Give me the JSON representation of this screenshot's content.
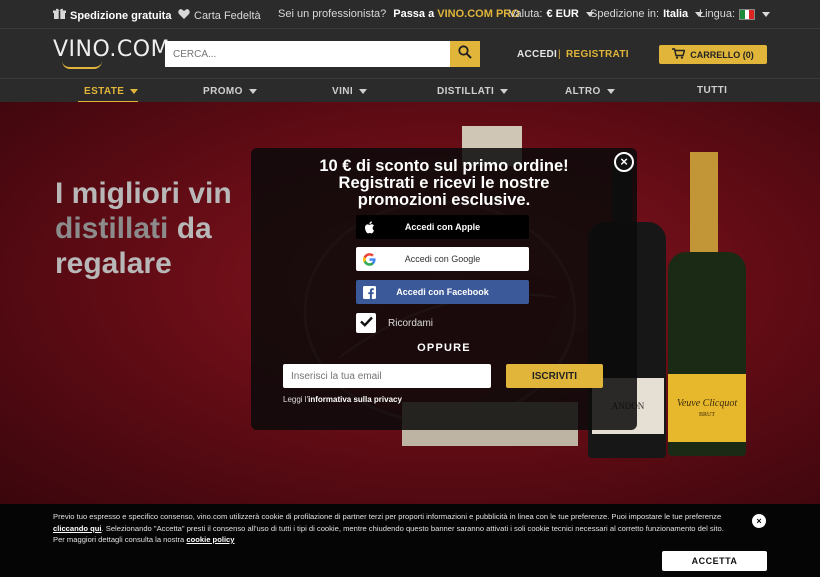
{
  "colors": {
    "accent": "#e0b53a",
    "header_bg": "#2b2b2b",
    "hero_bg": "#6a0e17",
    "facebook": "#3b5998"
  },
  "topbar": {
    "shipping": "Spedizione gratuita",
    "loyalty": "Carta Fedeltà",
    "pro_question": "Sei un professionista?",
    "pro_link_prefix": "Passa a",
    "pro_link": "VINO.COM PRO",
    "currency_label": "Valuta:",
    "currency_value": "€ EUR",
    "ship_label": "Spedizione in:",
    "ship_value": "Italia",
    "language_label": "Lingua:"
  },
  "header": {
    "logo": "VINO.COM",
    "search_placeholder": "CERCA...",
    "login": "ACCEDI",
    "separator": "|",
    "register": "REGISTRATI",
    "cart": "CARRELLO (0)"
  },
  "nav": {
    "items": [
      {
        "label": "ESTATE",
        "active": true,
        "dropdown": true
      },
      {
        "label": "PROMO",
        "dropdown": true
      },
      {
        "label": "VINI",
        "dropdown": true
      },
      {
        "label": "DISTILLATI",
        "dropdown": true
      },
      {
        "label": "ALTRO",
        "dropdown": true
      },
      {
        "label": "TUTTI",
        "dropdown": false
      }
    ]
  },
  "hero": {
    "line1": "I migliori vin",
    "line2_a": "distillati",
    "line2_b": "da",
    "line3": "regalare",
    "bottle_label_1": "ANDON",
    "bottle_label_2": "Veuve Clicquot",
    "bottle_label_3": "BRUT"
  },
  "modal": {
    "title_line1": "10 € di sconto sul primo ordine!",
    "title_line2": "Registrati e ricevi le nostre",
    "title_line3": "promozioni esclusive.",
    "apple": "Accedi con Apple",
    "google": "Accedi con Google",
    "facebook": "Accedi con Facebook",
    "remember": "Ricordami",
    "or": "OPPURE",
    "email_placeholder": "Inserisci la tua email",
    "subscribe": "ISCRIVITI",
    "privacy_prefix": "Leggi l'",
    "privacy_link": "informativa sulla privacy",
    "close": "×"
  },
  "cookie": {
    "text_1": "Previo tuo espresso e specifico consenso, vino.com utilizzerà cookie di profilazione di partner terzi per proporti informazioni e pubblicità in linea con le tue preferenze. Puoi impostare le tue preferenze ",
    "link_1": "cliccando qui",
    "text_2": ". Selezionando \"Accetta\" presti il consenso all'uso di tutti i tipi di cookie, mentre chiudendo questo banner saranno attivati i soli cookie tecnici necessari al corretto funzionamento del sito. Per maggiori dettagli consulta la nostra ",
    "link_2": "cookie policy",
    "accept": "ACCETTA",
    "close": "×"
  }
}
